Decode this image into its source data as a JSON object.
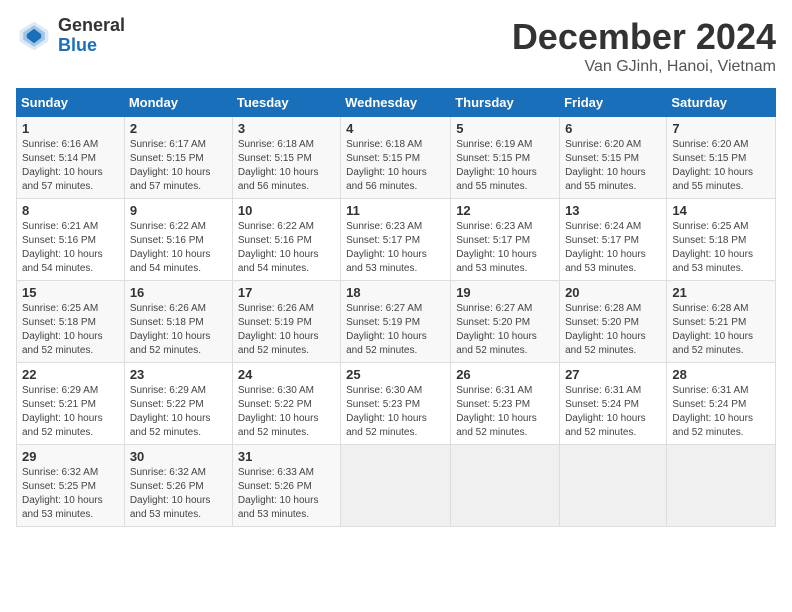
{
  "header": {
    "logo_general": "General",
    "logo_blue": "Blue",
    "month": "December 2024",
    "location": "Van GJinh, Hanoi, Vietnam"
  },
  "weekdays": [
    "Sunday",
    "Monday",
    "Tuesday",
    "Wednesday",
    "Thursday",
    "Friday",
    "Saturday"
  ],
  "weeks": [
    [
      {
        "day": "1",
        "sunrise": "6:16 AM",
        "sunset": "5:14 PM",
        "daylight": "10 hours and 57 minutes."
      },
      {
        "day": "2",
        "sunrise": "6:17 AM",
        "sunset": "5:15 PM",
        "daylight": "10 hours and 57 minutes."
      },
      {
        "day": "3",
        "sunrise": "6:18 AM",
        "sunset": "5:15 PM",
        "daylight": "10 hours and 56 minutes."
      },
      {
        "day": "4",
        "sunrise": "6:18 AM",
        "sunset": "5:15 PM",
        "daylight": "10 hours and 56 minutes."
      },
      {
        "day": "5",
        "sunrise": "6:19 AM",
        "sunset": "5:15 PM",
        "daylight": "10 hours and 55 minutes."
      },
      {
        "day": "6",
        "sunrise": "6:20 AM",
        "sunset": "5:15 PM",
        "daylight": "10 hours and 55 minutes."
      },
      {
        "day": "7",
        "sunrise": "6:20 AM",
        "sunset": "5:15 PM",
        "daylight": "10 hours and 55 minutes."
      }
    ],
    [
      {
        "day": "8",
        "sunrise": "6:21 AM",
        "sunset": "5:16 PM",
        "daylight": "10 hours and 54 minutes."
      },
      {
        "day": "9",
        "sunrise": "6:22 AM",
        "sunset": "5:16 PM",
        "daylight": "10 hours and 54 minutes."
      },
      {
        "day": "10",
        "sunrise": "6:22 AM",
        "sunset": "5:16 PM",
        "daylight": "10 hours and 54 minutes."
      },
      {
        "day": "11",
        "sunrise": "6:23 AM",
        "sunset": "5:17 PM",
        "daylight": "10 hours and 53 minutes."
      },
      {
        "day": "12",
        "sunrise": "6:23 AM",
        "sunset": "5:17 PM",
        "daylight": "10 hours and 53 minutes."
      },
      {
        "day": "13",
        "sunrise": "6:24 AM",
        "sunset": "5:17 PM",
        "daylight": "10 hours and 53 minutes."
      },
      {
        "day": "14",
        "sunrise": "6:25 AM",
        "sunset": "5:18 PM",
        "daylight": "10 hours and 53 minutes."
      }
    ],
    [
      {
        "day": "15",
        "sunrise": "6:25 AM",
        "sunset": "5:18 PM",
        "daylight": "10 hours and 52 minutes."
      },
      {
        "day": "16",
        "sunrise": "6:26 AM",
        "sunset": "5:18 PM",
        "daylight": "10 hours and 52 minutes."
      },
      {
        "day": "17",
        "sunrise": "6:26 AM",
        "sunset": "5:19 PM",
        "daylight": "10 hours and 52 minutes."
      },
      {
        "day": "18",
        "sunrise": "6:27 AM",
        "sunset": "5:19 PM",
        "daylight": "10 hours and 52 minutes."
      },
      {
        "day": "19",
        "sunrise": "6:27 AM",
        "sunset": "5:20 PM",
        "daylight": "10 hours and 52 minutes."
      },
      {
        "day": "20",
        "sunrise": "6:28 AM",
        "sunset": "5:20 PM",
        "daylight": "10 hours and 52 minutes."
      },
      {
        "day": "21",
        "sunrise": "6:28 AM",
        "sunset": "5:21 PM",
        "daylight": "10 hours and 52 minutes."
      }
    ],
    [
      {
        "day": "22",
        "sunrise": "6:29 AM",
        "sunset": "5:21 PM",
        "daylight": "10 hours and 52 minutes."
      },
      {
        "day": "23",
        "sunrise": "6:29 AM",
        "sunset": "5:22 PM",
        "daylight": "10 hours and 52 minutes."
      },
      {
        "day": "24",
        "sunrise": "6:30 AM",
        "sunset": "5:22 PM",
        "daylight": "10 hours and 52 minutes."
      },
      {
        "day": "25",
        "sunrise": "6:30 AM",
        "sunset": "5:23 PM",
        "daylight": "10 hours and 52 minutes."
      },
      {
        "day": "26",
        "sunrise": "6:31 AM",
        "sunset": "5:23 PM",
        "daylight": "10 hours and 52 minutes."
      },
      {
        "day": "27",
        "sunrise": "6:31 AM",
        "sunset": "5:24 PM",
        "daylight": "10 hours and 52 minutes."
      },
      {
        "day": "28",
        "sunrise": "6:31 AM",
        "sunset": "5:24 PM",
        "daylight": "10 hours and 52 minutes."
      }
    ],
    [
      {
        "day": "29",
        "sunrise": "6:32 AM",
        "sunset": "5:25 PM",
        "daylight": "10 hours and 53 minutes."
      },
      {
        "day": "30",
        "sunrise": "6:32 AM",
        "sunset": "5:26 PM",
        "daylight": "10 hours and 53 minutes."
      },
      {
        "day": "31",
        "sunrise": "6:33 AM",
        "sunset": "5:26 PM",
        "daylight": "10 hours and 53 minutes."
      },
      null,
      null,
      null,
      null
    ]
  ]
}
